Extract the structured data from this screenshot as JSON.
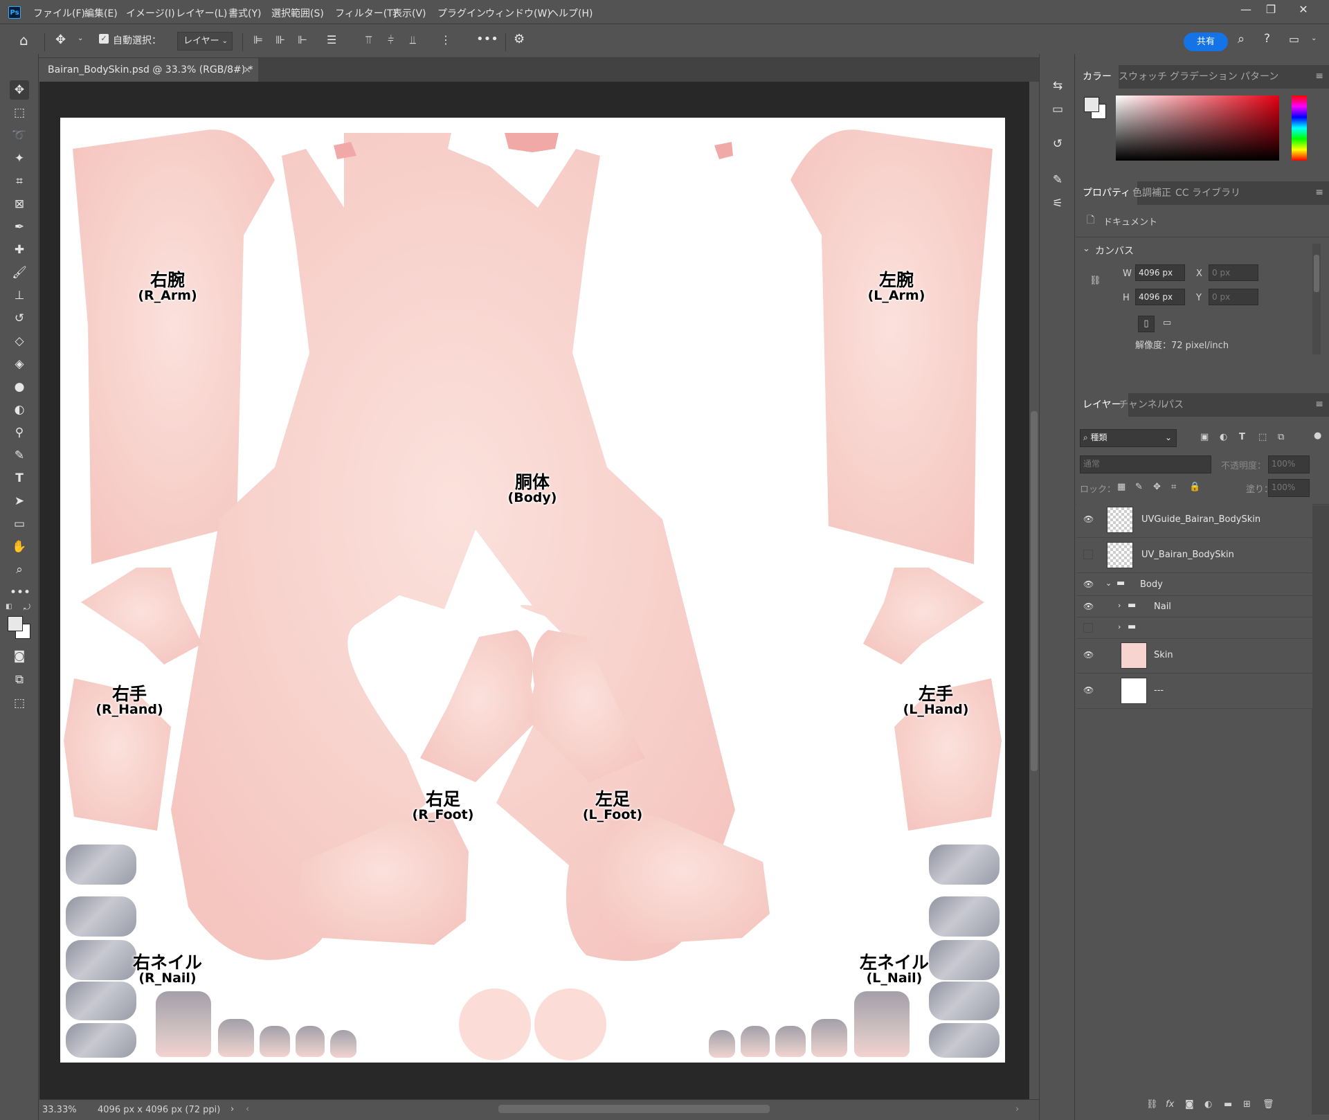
{
  "menu": [
    "ファイル(F)",
    "編集(E)",
    "イメージ(I)",
    "レイヤー(L)",
    "書式(Y)",
    "選択範囲(S)",
    "フィルター(T)",
    "表示(V)",
    "プラグイン",
    "ウィンドウ(W)",
    "ヘルプ(H)"
  ],
  "app_logo": "Ps",
  "options": {
    "auto_select_label": "自動選択：",
    "auto_select_value": "レイヤー",
    "share_label": "共有"
  },
  "document": {
    "tab_title": "Bairan_BodySkin.psd @ 33.3% (RGB/8#) *"
  },
  "status": {
    "zoom": "33.33%",
    "doc_info": "4096 px x 4096 px (72 ppi)"
  },
  "color_panel": {
    "tabs": [
      "カラー",
      "スウォッチ",
      "グラデーション",
      "パターン"
    ]
  },
  "properties_panel": {
    "tabs": [
      "プロパティ",
      "色調補正",
      "CC ライブラリ"
    ],
    "doc_label": "ドキュメント",
    "canvas_header": "カンバス",
    "w_label": "W",
    "w_value": "4096 px",
    "h_label": "H",
    "h_value": "4096 px",
    "x_label": "X",
    "x_value": "0 px",
    "y_label": "Y",
    "y_value": "0 px",
    "resolution": "解像度：72 pixel/inch"
  },
  "layers_panel": {
    "tabs": [
      "レイヤー",
      "チャンネル",
      "パス"
    ],
    "filter_kind": "種類",
    "blend_mode": "通常",
    "opacity_label": "不透明度：",
    "opacity_value": "100%",
    "lock_label": "ロック：",
    "fill_label": "塗り：",
    "fill_value": "100%",
    "layers": [
      {
        "name": "UVGuide_Bairan_BodySkin",
        "visible": true
      },
      {
        "name": "UV_Bairan_BodySkin",
        "visible": false
      },
      {
        "name": "Body",
        "visible": true
      },
      {
        "name": "Nail",
        "visible": true
      },
      {
        "name": "",
        "visible": false
      },
      {
        "name": "Skin",
        "visible": true
      },
      {
        "name": "---",
        "visible": true
      }
    ]
  },
  "uv_labels": {
    "r_arm": {
      "jp": "右腕",
      "en": "(R_Arm)"
    },
    "l_arm": {
      "jp": "左腕",
      "en": "(L_Arm)"
    },
    "body": {
      "jp": "胴体",
      "en": "(Body)"
    },
    "r_hand": {
      "jp": "右手",
      "en": "(R_Hand)"
    },
    "l_hand": {
      "jp": "左手",
      "en": "(L_Hand)"
    },
    "r_foot": {
      "jp": "右足",
      "en": "(R_Foot)"
    },
    "l_foot": {
      "jp": "左足",
      "en": "(L_Foot)"
    },
    "r_nail": {
      "jp": "右ネイル",
      "en": "(R_Nail)"
    },
    "l_nail": {
      "jp": "左ネイル",
      "en": "(L_Nail)"
    }
  },
  "colors": {
    "skin": "#f9d8d3",
    "accent": "#1473e6"
  },
  "icons": [
    "home-icon",
    "move-icon",
    "marquee-icon",
    "lasso-icon",
    "magic-wand-icon",
    "crop-icon",
    "frame-icon",
    "eyedropper-icon",
    "healing-icon",
    "brush-icon",
    "stamp-icon",
    "history-brush-icon",
    "eraser-icon",
    "bucket-icon",
    "blur-icon",
    "dodge-icon",
    "pen-icon",
    "type-icon",
    "path-select-icon",
    "rectangle-icon",
    "hand-icon",
    "zoom-icon",
    "search-icon",
    "help-icon",
    "gear-icon",
    "eye-icon",
    "folder-icon"
  ]
}
